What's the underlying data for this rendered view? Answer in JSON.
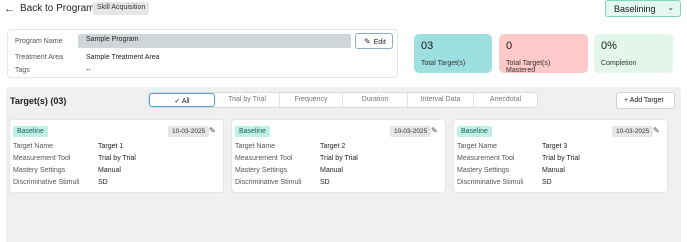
{
  "header": {
    "title": "Back to Program",
    "skill_badge": "Skill Acquisition",
    "status_value": "Baselining"
  },
  "program": {
    "labels": {
      "name": "Program Name",
      "area": "Treatment Area",
      "tags": "Tags"
    },
    "name_value": "Sample Program",
    "area_value": "Sample Treatment Area",
    "tags_value": "--",
    "edit_label": "Edit"
  },
  "stats": [
    {
      "value": "03",
      "label": "Total Target(s)",
      "color": "#9ee0e0"
    },
    {
      "value": "0",
      "label": "Total Target(s) Mastered",
      "color": "#ffc9c9"
    },
    {
      "value": "0%",
      "label": "Completion",
      "color": "#e3f6ec"
    }
  ],
  "targets": {
    "title": "Target(s) (03)",
    "tabs": [
      "All",
      "Trial by Trial",
      "Frequency",
      "Duration",
      "Interval Data",
      "Anecdotal"
    ],
    "active_tab": "All",
    "add_label": "+ Add Target",
    "field_labels": {
      "name": "Target Name",
      "tool": "Measurement Tool",
      "mastery": "Mastery Settings",
      "stimuli": "Discriminative Stimuli"
    },
    "cards": [
      {
        "status": "Baseline",
        "date": "10-03-2025",
        "name": "Target 1",
        "tool": "Trial by Trial",
        "mastery": "Manual",
        "stimuli": "SD"
      },
      {
        "status": "Baseline",
        "date": "10-03-2025",
        "name": "Target 2",
        "tool": "Trial by Trial",
        "mastery": "Manual",
        "stimuli": "SD"
      },
      {
        "status": "Baseline",
        "date": "10-03-2025",
        "name": "Target 3",
        "tool": "Trial by Trial",
        "mastery": "Manual",
        "stimuli": "SD"
      }
    ]
  },
  "colors": {
    "accent_teal": "#7fd6c2",
    "badge_teal": "#bff0e5",
    "panel_bg": "#eef0f2"
  }
}
